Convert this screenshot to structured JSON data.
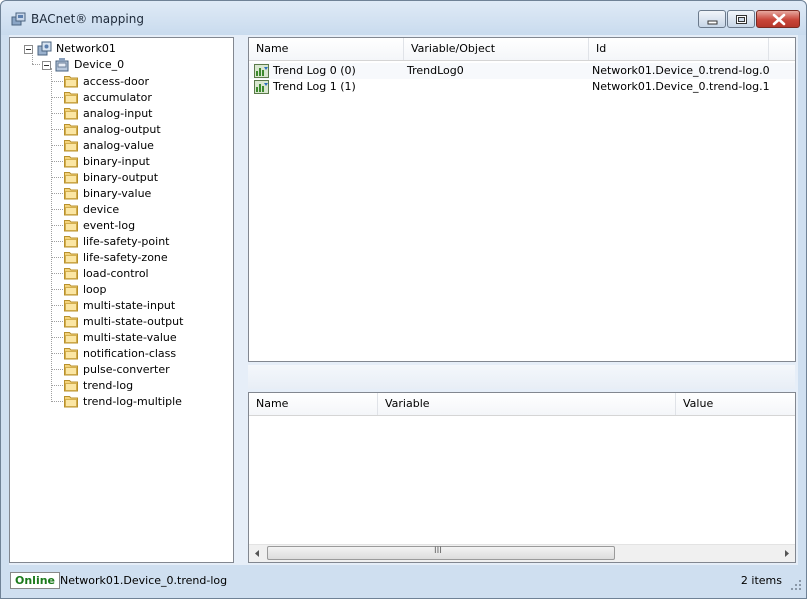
{
  "window": {
    "title": "BACnet® mapping",
    "icon": "network-app-icon",
    "buttons": [
      "minimize",
      "maximize",
      "close"
    ]
  },
  "tree": {
    "root": {
      "label": "Network01",
      "icon": "network-icon",
      "expanded": true
    },
    "device": {
      "label": "Device_0",
      "icon": "device-icon",
      "expanded": true
    },
    "object_types": [
      "access-door",
      "accumulator",
      "analog-input",
      "analog-output",
      "analog-value",
      "binary-input",
      "binary-output",
      "binary-value",
      "device",
      "event-log",
      "life-safety-point",
      "life-safety-zone",
      "load-control",
      "loop",
      "multi-state-input",
      "multi-state-output",
      "multi-state-value",
      "notification-class",
      "pulse-converter",
      "trend-log",
      "trend-log-multiple"
    ]
  },
  "objects_grid": {
    "columns": [
      "Name",
      "Variable/Object",
      "Id"
    ],
    "rows": [
      {
        "name": "Trend Log 0 (0)",
        "variable": "TrendLog0",
        "id": "Network01.Device_0.trend-log.0",
        "icon": "trend-log-icon"
      },
      {
        "name": "Trend Log 1 (1)",
        "variable": "",
        "id": "Network01.Device_0.trend-log.1",
        "icon": "trend-log-icon"
      }
    ]
  },
  "properties_grid": {
    "columns": [
      "Name",
      "Variable",
      "Value"
    ],
    "rows": [],
    "scroll_glyph": "III"
  },
  "status": {
    "state": "Online",
    "path": "Network01.Device_0.trend-log",
    "count": "2 items",
    "colors": {
      "online": "#1c7a1c"
    }
  }
}
